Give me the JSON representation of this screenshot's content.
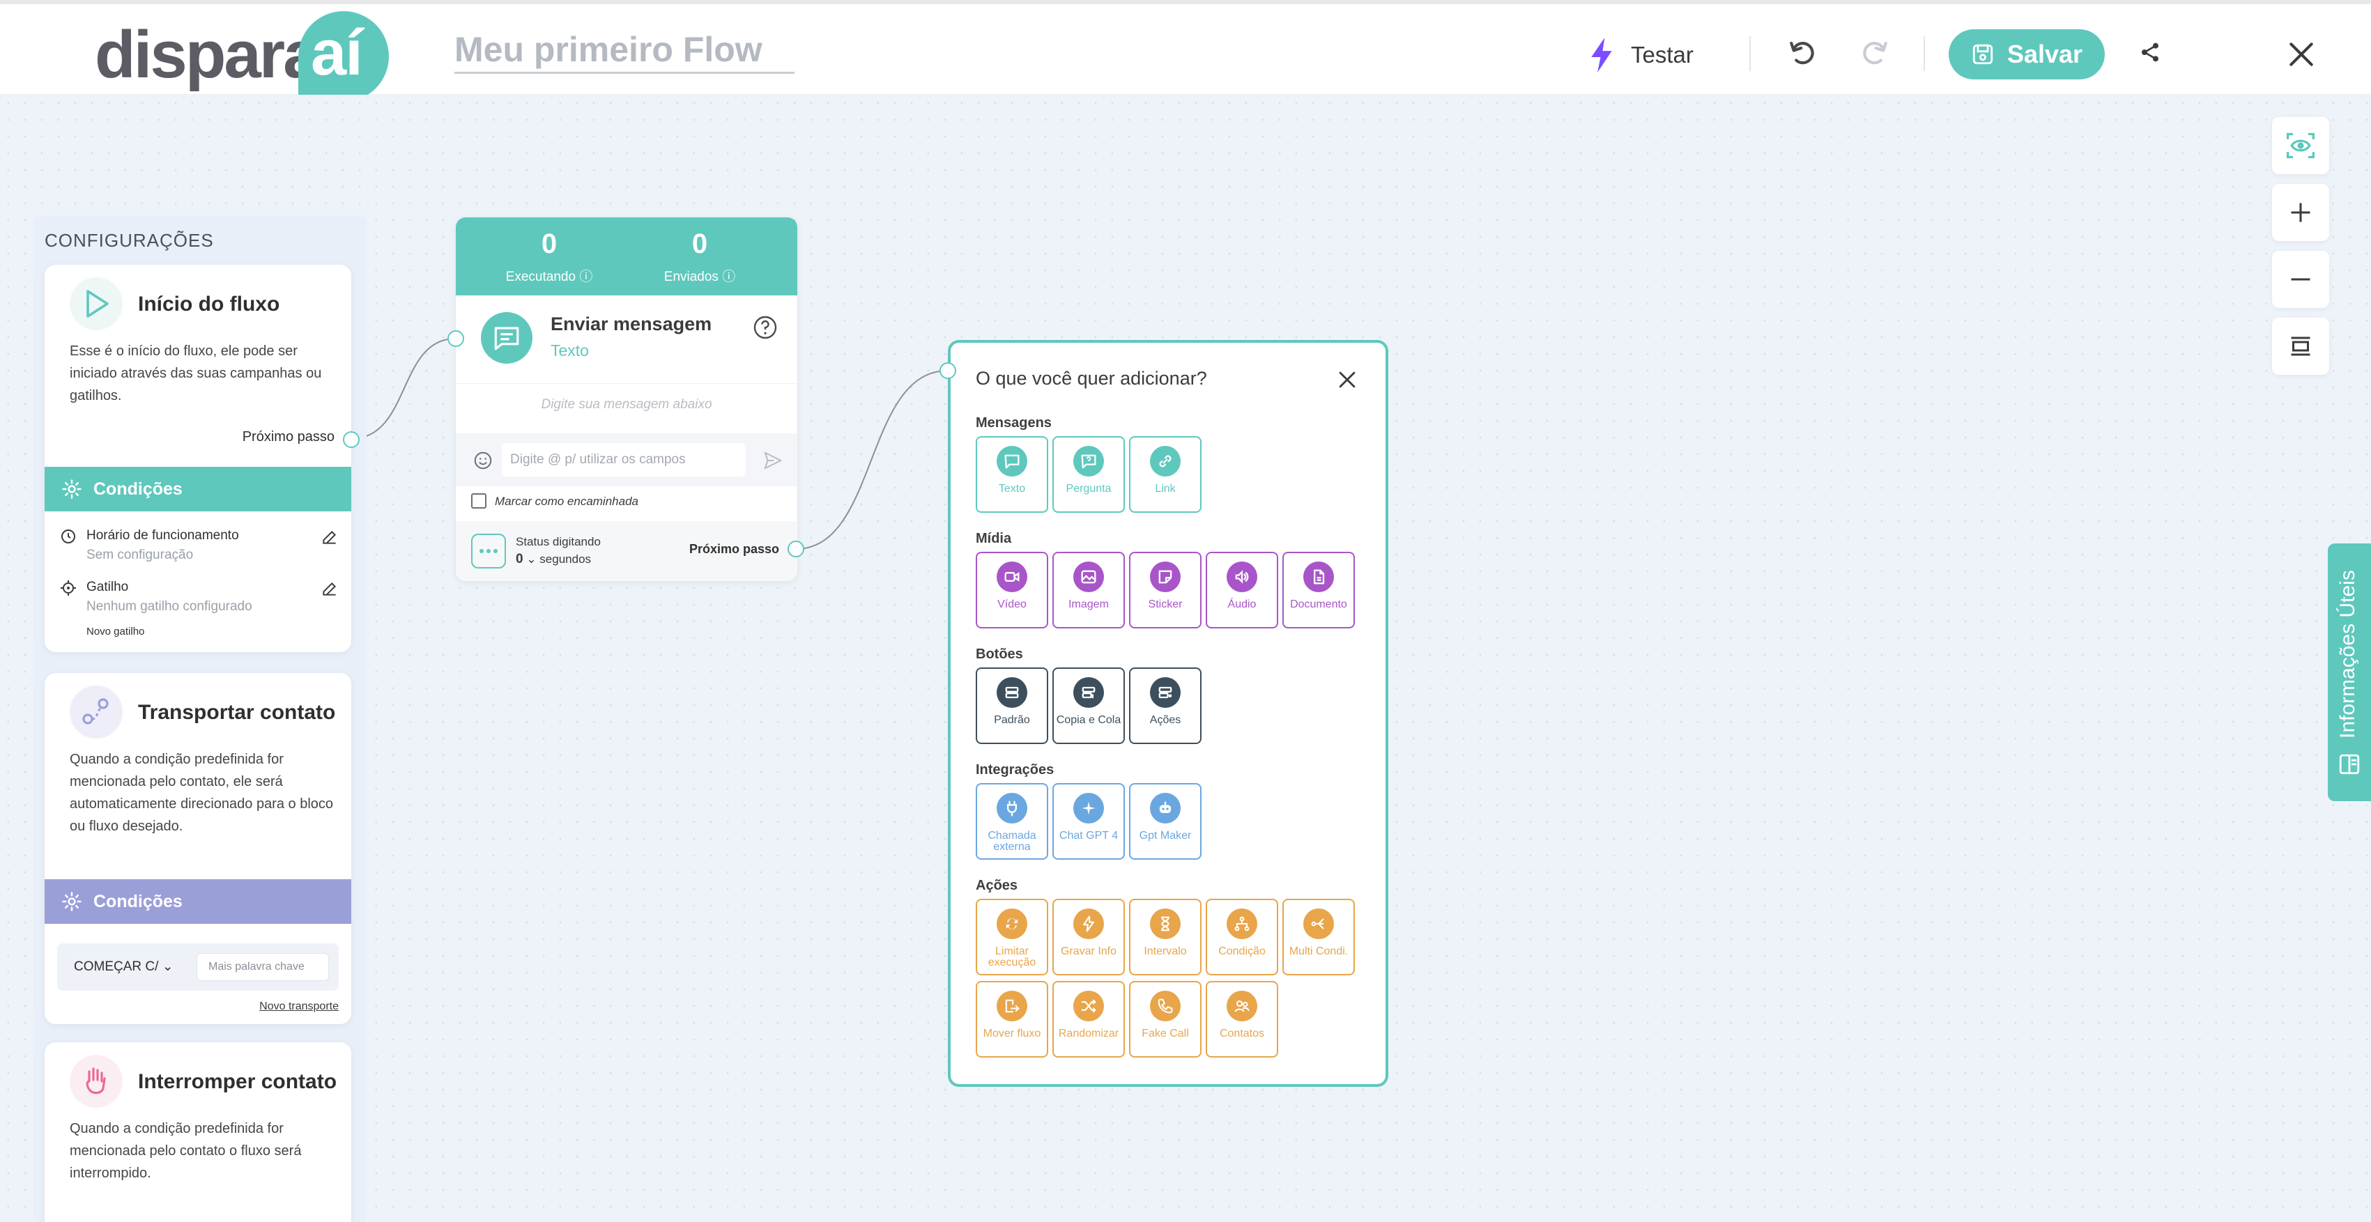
{
  "header": {
    "logo_word": "dispara",
    "logo_ai": "aí",
    "flow_title": "Meu primeiro Flow",
    "test_label": "Testar",
    "save_label": "Salvar"
  },
  "side_tab": {
    "label": "Informações Úteis"
  },
  "left_panel": {
    "title": "CONFIGURAÇÕES",
    "start_card": {
      "title": "Início do fluxo",
      "description": "Esse é o início do fluxo, ele pode ser iniciado através das suas campanhas ou gatilhos.",
      "next_step": "Próximo passo",
      "conditions_label": "Condições",
      "schedule_label": "Horário de funcionamento",
      "schedule_value": "Sem configuração",
      "trigger_label": "Gatilho",
      "trigger_value": "Nenhum gatilho configurado",
      "new_trigger": "Novo gatilho"
    },
    "transport_card": {
      "title": "Transportar contato",
      "description": "Quando a condição predefinida for mencionada pelo contato, ele será automaticamente direcionado para o bloco ou fluxo desejado.",
      "conditions_label": "Condições",
      "select_value": "COMEÇAR C/",
      "keyword_placeholder": "Mais palavra chave",
      "new_transport": "Novo transporte"
    },
    "interrupt_card": {
      "title": "Interromper contato",
      "description": "Quando a condição predefinida for mencionada pelo contato o fluxo será interrompido."
    }
  },
  "node": {
    "executing_value": "0",
    "executing_label": "Executando",
    "sent_value": "0",
    "sent_label": "Enviados",
    "title": "Enviar mensagem",
    "subtitle": "Texto",
    "message_placeholder": "Digite sua mensagem abaixo",
    "input_placeholder": "Digite @ p/ utilizar os campos",
    "forwarded_label": "Marcar como encaminhada",
    "typing_label": "Status digitando",
    "typing_value": "0",
    "typing_unit": "segundos",
    "next_step": "Próximo passo"
  },
  "popup": {
    "title": "O que você quer adicionar?",
    "sections": [
      {
        "title": "Mensagens",
        "color": "#5ec8bd",
        "items": [
          {
            "label": "Texto",
            "icon": "chat-icon"
          },
          {
            "label": "Pergunta",
            "icon": "question-chat-icon"
          },
          {
            "label": "Link",
            "icon": "link-icon"
          }
        ]
      },
      {
        "title": "Mídia",
        "color": "#a855c9",
        "items": [
          {
            "label": "Vídeo",
            "icon": "video-icon"
          },
          {
            "label": "Imagem",
            "icon": "image-icon"
          },
          {
            "label": "Sticker",
            "icon": "sticker-icon"
          },
          {
            "label": "Áudio",
            "icon": "audio-icon"
          },
          {
            "label": "Documento",
            "icon": "document-icon"
          }
        ]
      },
      {
        "title": "Botões",
        "color": "#3d4f5c",
        "items": [
          {
            "label": "Padrão",
            "icon": "button-icon"
          },
          {
            "label": "Copia e Cola",
            "icon": "copy-button-icon"
          },
          {
            "label": "Ações",
            "icon": "action-button-icon"
          }
        ]
      },
      {
        "title": "Integrações",
        "color": "#6aa7e0",
        "items": [
          {
            "label": "Chamada externa",
            "icon": "plug-icon"
          },
          {
            "label": "Chat GPT 4",
            "icon": "sparkle-icon"
          },
          {
            "label": "Gpt Maker",
            "icon": "bot-icon"
          }
        ]
      },
      {
        "title": "Ações",
        "color": "#e8a54a",
        "items": [
          {
            "label": "Limitar execução",
            "icon": "repeat-icon"
          },
          {
            "label": "Gravar Info",
            "icon": "bolt-icon"
          },
          {
            "label": "Intervalo",
            "icon": "hourglass-icon"
          },
          {
            "label": "Condição",
            "icon": "branch-icon"
          },
          {
            "label": "Multi Condi.",
            "icon": "multi-branch-icon"
          },
          {
            "label": "Mover fluxo",
            "icon": "move-icon"
          },
          {
            "label": "Randomizar",
            "icon": "shuffle-icon"
          },
          {
            "label": "Fake Call",
            "icon": "phone-icon"
          },
          {
            "label": "Contatos",
            "icon": "contacts-icon"
          }
        ]
      }
    ]
  },
  "colors": {
    "accent": "#5ec8bd",
    "purple_bar": "#9b9fd8",
    "canvas": "#eef3fa"
  }
}
